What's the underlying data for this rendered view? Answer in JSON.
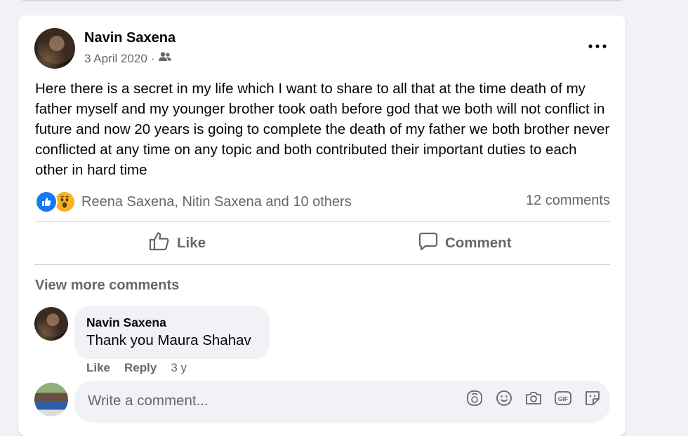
{
  "post": {
    "author": "Navin Saxena",
    "date": "3 April 2020",
    "separator": "·",
    "audience_icon": "friends-icon",
    "more_icon": "more-options-icon",
    "text": "Here there is a secret in my life which I want to share to all that at the time death of my father myself and my younger brother took oath before god that we both will not conflict in future and now 20 years is going to complete the death of my father we both brother never conflicted at any time on any topic and both contributed their important duties to each other in hard time"
  },
  "reactions": {
    "icons": [
      "like-reaction-icon",
      "wow-reaction-icon"
    ],
    "names": "Reena Saxena, Nitin Saxena and 10 others",
    "comments_count": "12 comments"
  },
  "actions": {
    "like_label": "Like",
    "comment_label": "Comment"
  },
  "comments": {
    "view_more": "View more comments",
    "items": [
      {
        "author": "Navin Saxena",
        "text": "Thank you Maura Shahav",
        "like_label": "Like",
        "reply_label": "Reply",
        "time": "3 y"
      }
    ]
  },
  "composer": {
    "placeholder": "Write a comment...",
    "tools": [
      "avatar-sticker-icon",
      "emoji-icon",
      "camera-icon",
      "gif-icon",
      "sticker-icon"
    ]
  },
  "colors": {
    "like_blue": "#1877f2",
    "wow_yellow": "#f7b125",
    "secondary_text": "#65676b",
    "background": "#f0f2f5"
  }
}
